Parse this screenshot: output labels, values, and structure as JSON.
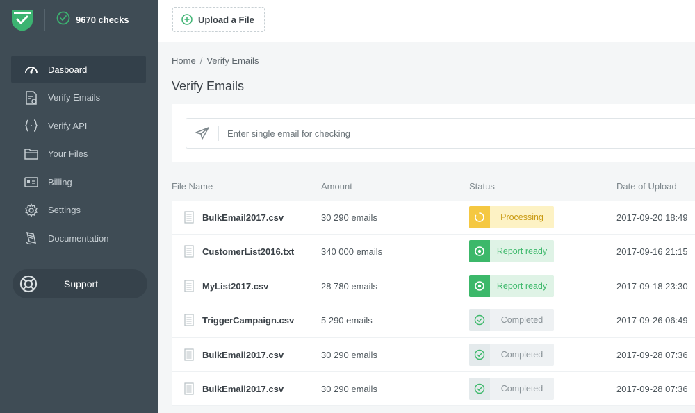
{
  "header": {
    "checks": "9670 checks",
    "upload_label": "Upload a File"
  },
  "colors": {
    "sidebar": "#3f4c55",
    "brand_green": "#3cb371",
    "processing_bg": "#fdf2c4",
    "processing_icon": "#f5c842",
    "ready_bg": "#dff3e6",
    "ready_icon": "#3cb86a",
    "completed_bg": "#eef1f3"
  },
  "sidebar": {
    "items": [
      {
        "label": "Dasboard",
        "icon": "gauge-icon",
        "active": true
      },
      {
        "label": "Verify Emails",
        "icon": "document-check-icon"
      },
      {
        "label": "Verify API",
        "icon": "code-braces-icon"
      },
      {
        "label": "Your Files",
        "icon": "folder-icon"
      },
      {
        "label": "Billing",
        "icon": "credit-card-icon"
      },
      {
        "label": "Settings",
        "icon": "gear-icon"
      },
      {
        "label": "Documentation",
        "icon": "book-icon"
      }
    ],
    "support_label": "Support"
  },
  "breadcrumb": {
    "home": "Home",
    "sep": "/",
    "current": "Verify Emails"
  },
  "page": {
    "title": "Verify Emails"
  },
  "search": {
    "placeholder": "Enter single email for checking"
  },
  "table": {
    "headers": {
      "file_name": "File Name",
      "amount": "Amount",
      "status": "Status",
      "date": "Date of Upload"
    },
    "rows": [
      {
        "file": "BulkEmail2017.csv",
        "amount": "30 290 emails",
        "status": "Processing",
        "type": "processing",
        "date": "2017-09-20 18:49"
      },
      {
        "file": "CustomerList2016.txt",
        "amount": "340 000 emails",
        "status": "Report ready",
        "type": "ready",
        "date": "2017-09-16 21:15"
      },
      {
        "file": "MyList2017.csv",
        "amount": "28 780 emails",
        "status": "Report ready",
        "type": "ready",
        "date": "2017-09-18 23:30"
      },
      {
        "file": "TriggerCampaign.csv",
        "amount": "5 290 emails",
        "status": "Completed",
        "type": "completed",
        "date": "2017-09-26 06:49"
      },
      {
        "file": "BulkEmail2017.csv",
        "amount": "30 290 emails",
        "status": "Completed",
        "type": "completed",
        "date": "2017-09-28 07:36"
      },
      {
        "file": "BulkEmail2017.csv",
        "amount": "30 290 emails",
        "status": "Completed",
        "type": "completed",
        "date": "2017-09-28 07:36"
      }
    ]
  }
}
